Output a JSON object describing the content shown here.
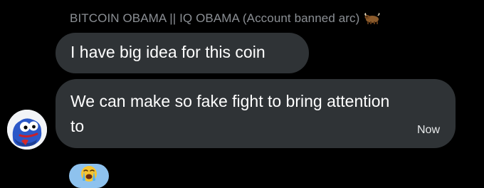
{
  "conversation": {
    "sender": {
      "name": "BITCOIN OBAMA || IQ OBAMA (Account banned arc)",
      "name_emoji": "ox-icon"
    },
    "messages": [
      {
        "lines": [
          "I have big idea for this coin"
        ]
      },
      {
        "lines": [
          "We can make so fake fight to bring attention",
          "to"
        ],
        "time": "Now"
      }
    ],
    "reaction": {
      "icon": "loudly-crying-face-icon"
    },
    "avatar": {
      "icon": "pepe-frog-avatar-icon"
    }
  },
  "colors": {
    "background": "#000000",
    "bubble": "#2f3336",
    "sender_name": "#8b8f94",
    "reaction_pill": "#8ec2ee"
  }
}
